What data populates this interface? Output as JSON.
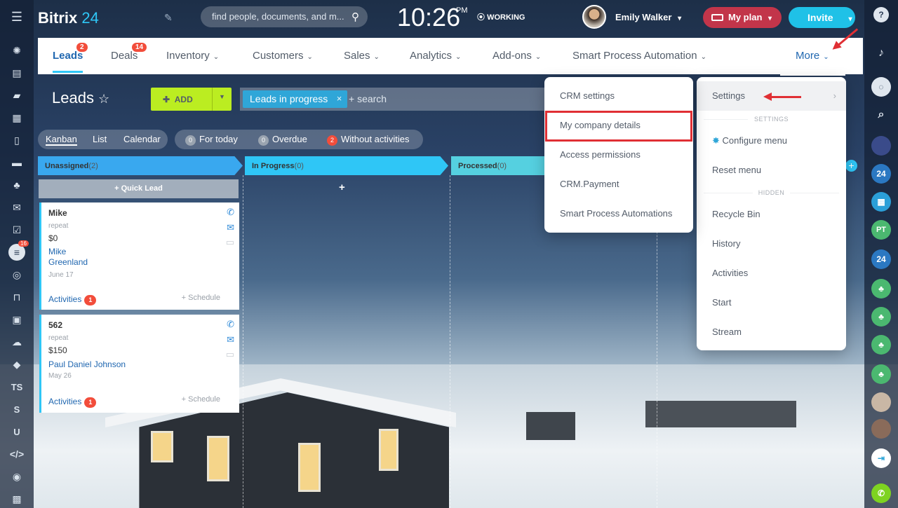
{
  "header": {
    "logo_text": "Bitrix",
    "logo_num": "24",
    "search_placeholder": "find people, documents, and m...",
    "time": "10:26",
    "ampm": "PM",
    "work_status": "WORKING",
    "user_name": "Emily Walker",
    "plan_label": "My plan",
    "invite_label": "Invite"
  },
  "nav": {
    "tabs": [
      {
        "label": "Leads",
        "badge": "2"
      },
      {
        "label": "Deals",
        "badge": "14"
      },
      {
        "label": "Inventory"
      },
      {
        "label": "Customers"
      },
      {
        "label": "Sales"
      },
      {
        "label": "Analytics"
      },
      {
        "label": "Add-ons"
      },
      {
        "label": "Smart Process Automation"
      },
      {
        "label": "More"
      }
    ]
  },
  "page": {
    "title": "Leads",
    "add_label": "ADD",
    "filter_tag": "Leads in progress",
    "filter_search": "+ search",
    "views": [
      "Kanban",
      "List",
      "Calendar"
    ],
    "counters": [
      {
        "count": "0",
        "label": "For today"
      },
      {
        "count": "0",
        "label": "Overdue"
      },
      {
        "count": "2",
        "label": "Without activities"
      }
    ]
  },
  "kanban": {
    "columns": [
      {
        "name": "Unassigned",
        "count": "(2)",
        "color": "#39a8ef"
      },
      {
        "name": "In Progress",
        "count": "(0)",
        "color": "#2fc6f6"
      },
      {
        "name": "Processed",
        "count": "(0)",
        "color": "#55d0e0"
      }
    ],
    "quick_lead": "+ Quick Lead",
    "cards": [
      {
        "title": "Mike",
        "repeat": "repeat",
        "amount": "$0",
        "contact": "Mike Greenland",
        "date": "June 17",
        "activities": "Activities",
        "act_count": "1",
        "schedule": "+ Schedule"
      },
      {
        "title": "562",
        "repeat": "repeat",
        "amount": "$150",
        "contact": "Paul Daniel Johnson",
        "date": "May 26",
        "activities": "Activities",
        "act_count": "1",
        "schedule": "+ Schedule"
      }
    ]
  },
  "more_menu": {
    "settings_label": "Settings",
    "section_settings": "SETTINGS",
    "configure": "Configure menu",
    "reset": "Reset menu",
    "section_hidden": "HIDDEN",
    "hidden_items": [
      "Recycle Bin",
      "History",
      "Activities",
      "Start",
      "Stream"
    ]
  },
  "settings_submenu": {
    "items": [
      "CRM settings",
      "My company details",
      "Access permissions",
      "CRM.Payment",
      "Smart Process Automations"
    ]
  },
  "leftbar": {
    "badge_count": "16",
    "text_items": [
      "TS",
      "S",
      "U"
    ]
  },
  "rightbar": {
    "items": [
      "24",
      "PT",
      "24"
    ]
  },
  "colors": {
    "accent": "#2fc7f7",
    "badge": "#f24d3b",
    "highlight": "#e02f34",
    "add_button": "#bbed21"
  }
}
